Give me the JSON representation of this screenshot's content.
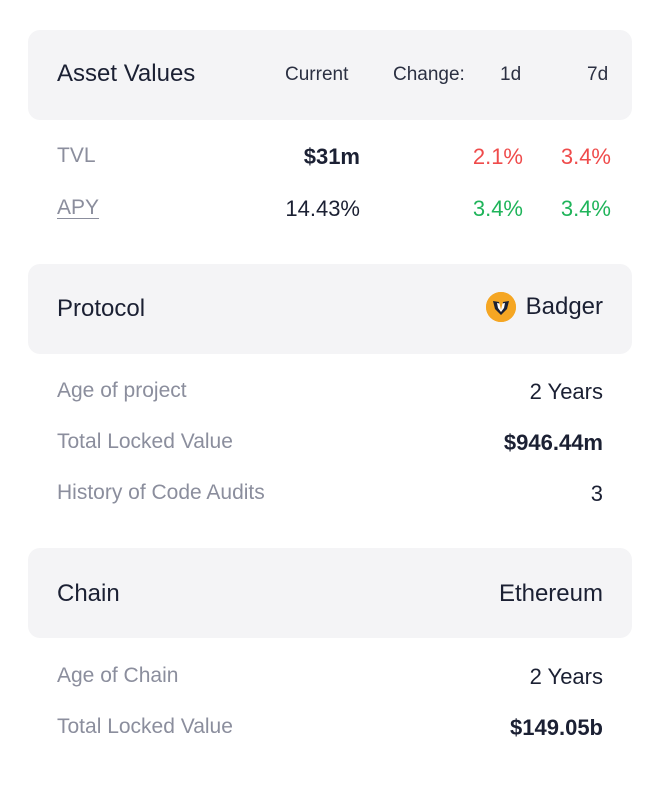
{
  "asset_values": {
    "title": "Asset Values",
    "col_current": "Current",
    "col_change": "Change:",
    "col_1d": "1d",
    "col_7d": "7d",
    "rows": [
      {
        "label": "TVL",
        "current": "$31m",
        "change_1d": "2.1%",
        "change_7d": "3.4%"
      },
      {
        "label": "APY",
        "current": "14.43%",
        "change_1d": "3.4%",
        "change_7d": "3.4%"
      }
    ]
  },
  "protocol": {
    "title": "Protocol",
    "name": "Badger",
    "icon": "badger-icon",
    "rows": [
      {
        "label": "Age of project",
        "value": "2 Years"
      },
      {
        "label": "Total Locked Value",
        "value": "$946.44m"
      },
      {
        "label": "History of Code Audits",
        "value": "3"
      }
    ]
  },
  "chain": {
    "title": "Chain",
    "name": "Ethereum",
    "rows": [
      {
        "label": "Age of Chain",
        "value": "2 Years"
      },
      {
        "label": "Total Locked Value",
        "value": "$149.05b"
      }
    ]
  },
  "colors": {
    "negative": "#ef4b4b",
    "positive": "#1fb45a",
    "header_bg": "#f4f4f6",
    "badger_orange": "#f5a623"
  }
}
